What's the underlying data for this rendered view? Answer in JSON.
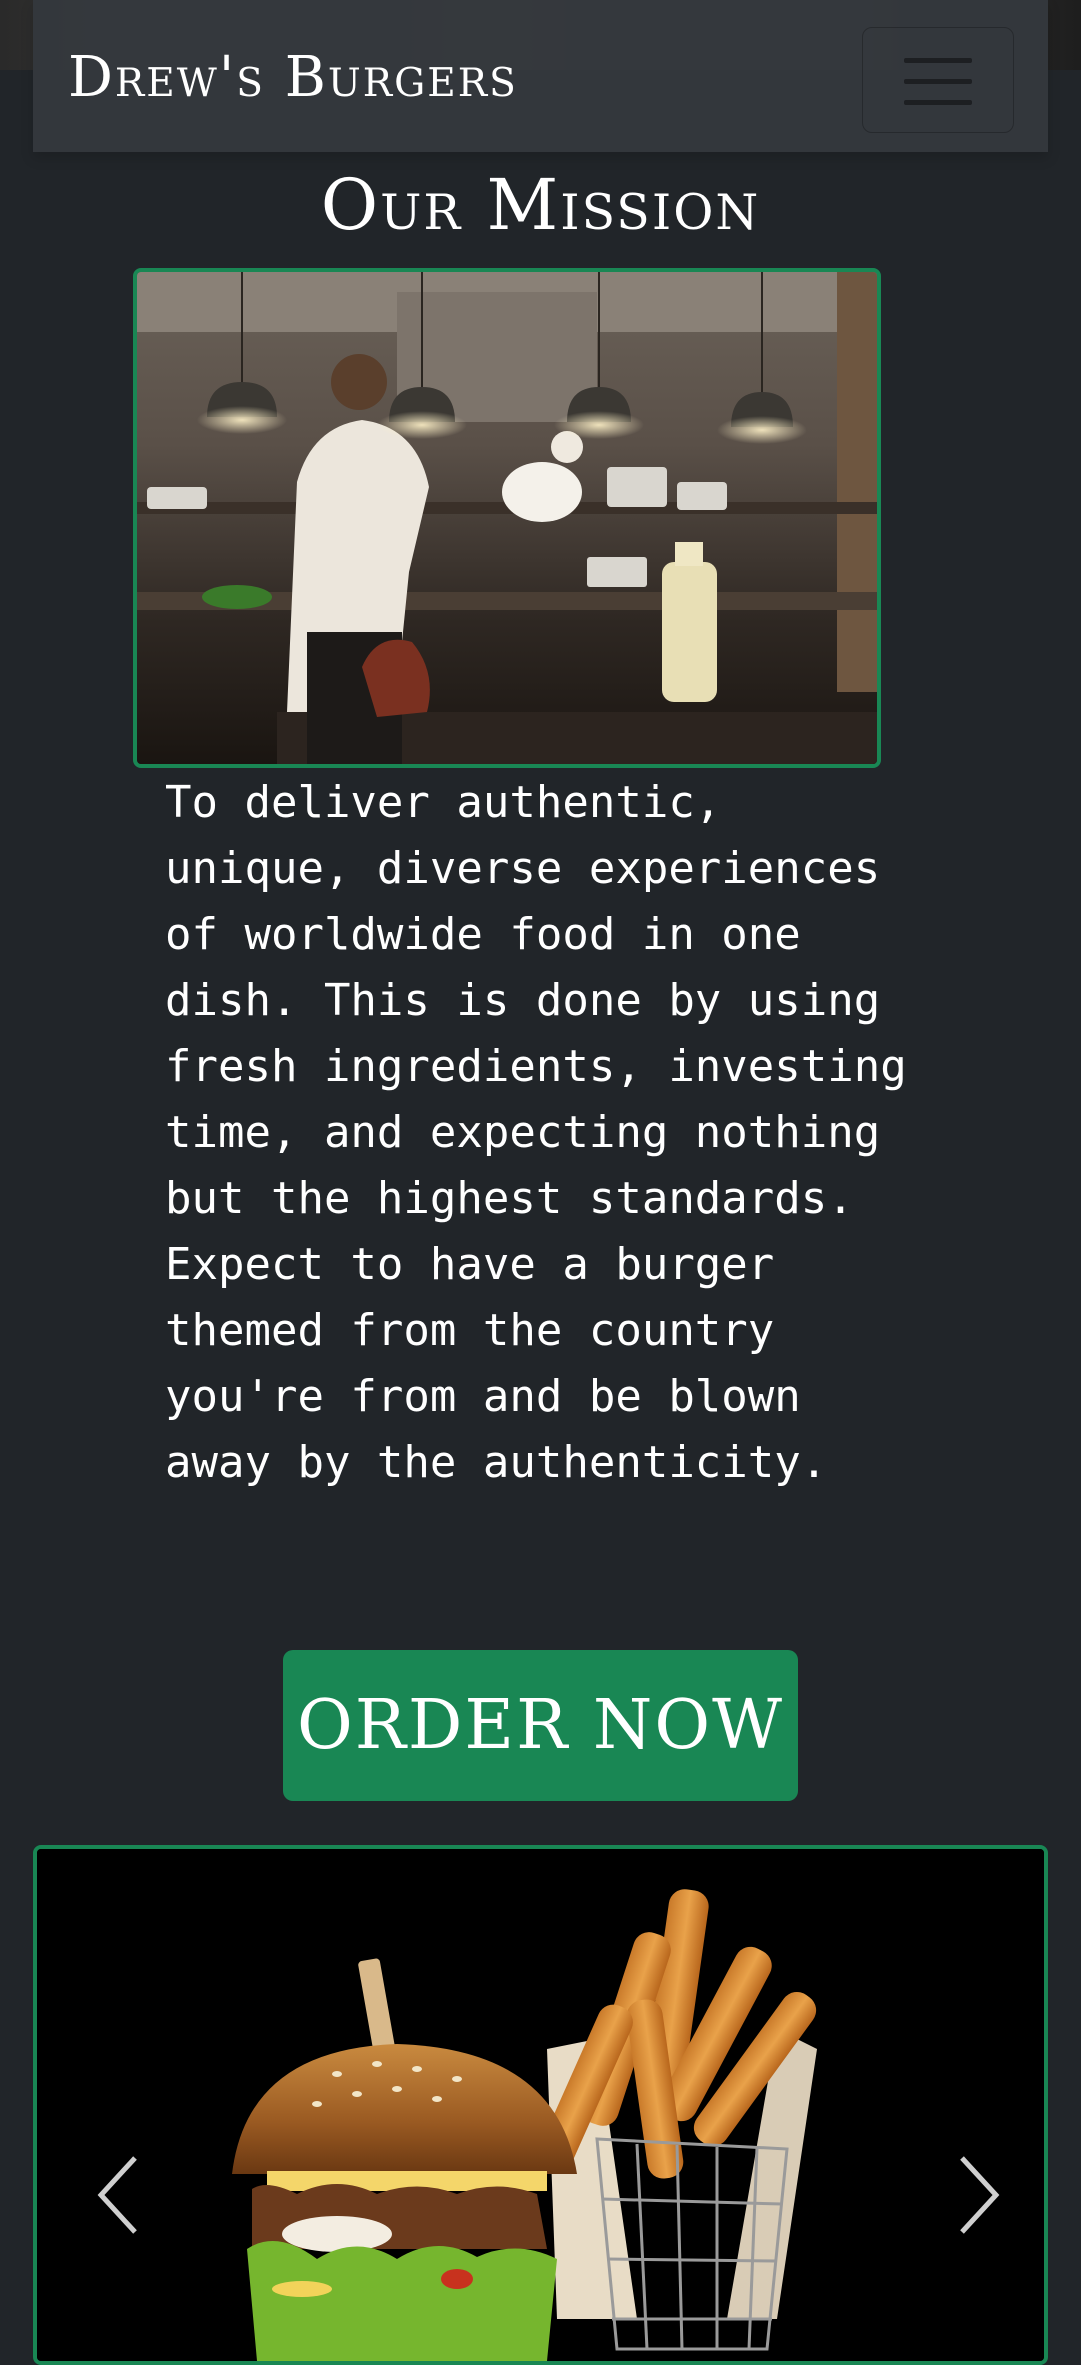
{
  "navbar": {
    "brand": "Drew's Burgers",
    "toggler_icon": "hamburger-menu-icon"
  },
  "mission": {
    "title": "Our Mission",
    "body": "To deliver authentic, unique, diverse experiences of worldwide food in one dish. This is done by using fresh ingredients, investing time, and expecting nothing but the highest standards. Expect to have a burger themed from the country you're from and be blown away by the authenticity."
  },
  "cta": {
    "label": "ORDER NOW"
  },
  "carousel": {
    "prev_icon": "chevron-left-icon",
    "next_icon": "chevron-right-icon"
  },
  "colors": {
    "background": "#212529",
    "navbar": "#34383d",
    "accent_green": "#198754",
    "text": "#ffffff"
  }
}
